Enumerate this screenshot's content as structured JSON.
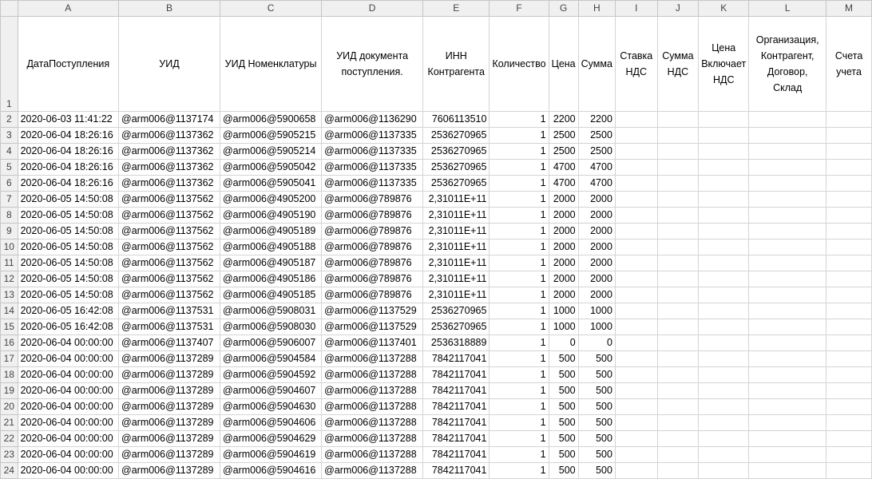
{
  "columns": [
    "A",
    "B",
    "C",
    "D",
    "E",
    "F",
    "G",
    "H",
    "I",
    "J",
    "K",
    "L",
    "M"
  ],
  "header_row_number": "1",
  "headers": [
    "ДатаПоступления",
    "УИД",
    "УИД Номенклатуры",
    "УИД документа поступления.",
    "ИНН Контрагента",
    "Количество",
    "Цена",
    "Сумма",
    "Ставка НДС",
    "Сумма НДС",
    "Цена Включает НДС",
    "Организация, Контрагент, Договор, Склад",
    "Счета учета"
  ],
  "rows": [
    {
      "n": "2",
      "date": "2020-06-03 11:41:22",
      "uid": "@arm006@1137174",
      "nom": "@arm006@5900658",
      "doc": "@arm006@1136290",
      "inn": "7606113510",
      "qty": "1",
      "price": "2200",
      "sum": "2200"
    },
    {
      "n": "3",
      "date": "2020-06-04 18:26:16",
      "uid": "@arm006@1137362",
      "nom": "@arm006@5905215",
      "doc": "@arm006@1137335",
      "inn": "2536270965",
      "qty": "1",
      "price": "2500",
      "sum": "2500"
    },
    {
      "n": "4",
      "date": "2020-06-04 18:26:16",
      "uid": "@arm006@1137362",
      "nom": "@arm006@5905214",
      "doc": "@arm006@1137335",
      "inn": "2536270965",
      "qty": "1",
      "price": "2500",
      "sum": "2500"
    },
    {
      "n": "5",
      "date": "2020-06-04 18:26:16",
      "uid": "@arm006@1137362",
      "nom": "@arm006@5905042",
      "doc": "@arm006@1137335",
      "inn": "2536270965",
      "qty": "1",
      "price": "4700",
      "sum": "4700"
    },
    {
      "n": "6",
      "date": "2020-06-04 18:26:16",
      "uid": "@arm006@1137362",
      "nom": "@arm006@5905041",
      "doc": "@arm006@1137335",
      "inn": "2536270965",
      "qty": "1",
      "price": "4700",
      "sum": "4700"
    },
    {
      "n": "7",
      "date": "2020-06-05 14:50:08",
      "uid": "@arm006@1137562",
      "nom": "@arm006@4905200",
      "doc": "@arm006@789876",
      "inn": "2,31011E+11",
      "qty": "1",
      "price": "2000",
      "sum": "2000"
    },
    {
      "n": "8",
      "date": "2020-06-05 14:50:08",
      "uid": "@arm006@1137562",
      "nom": "@arm006@4905190",
      "doc": "@arm006@789876",
      "inn": "2,31011E+11",
      "qty": "1",
      "price": "2000",
      "sum": "2000"
    },
    {
      "n": "9",
      "date": "2020-06-05 14:50:08",
      "uid": "@arm006@1137562",
      "nom": "@arm006@4905189",
      "doc": "@arm006@789876",
      "inn": "2,31011E+11",
      "qty": "1",
      "price": "2000",
      "sum": "2000"
    },
    {
      "n": "10",
      "date": "2020-06-05 14:50:08",
      "uid": "@arm006@1137562",
      "nom": "@arm006@4905188",
      "doc": "@arm006@789876",
      "inn": "2,31011E+11",
      "qty": "1",
      "price": "2000",
      "sum": "2000"
    },
    {
      "n": "11",
      "date": "2020-06-05 14:50:08",
      "uid": "@arm006@1137562",
      "nom": "@arm006@4905187",
      "doc": "@arm006@789876",
      "inn": "2,31011E+11",
      "qty": "1",
      "price": "2000",
      "sum": "2000"
    },
    {
      "n": "12",
      "date": "2020-06-05 14:50:08",
      "uid": "@arm006@1137562",
      "nom": "@arm006@4905186",
      "doc": "@arm006@789876",
      "inn": "2,31011E+11",
      "qty": "1",
      "price": "2000",
      "sum": "2000"
    },
    {
      "n": "13",
      "date": "2020-06-05 14:50:08",
      "uid": "@arm006@1137562",
      "nom": "@arm006@4905185",
      "doc": "@arm006@789876",
      "inn": "2,31011E+11",
      "qty": "1",
      "price": "2000",
      "sum": "2000"
    },
    {
      "n": "14",
      "date": "2020-06-05 16:42:08",
      "uid": "@arm006@1137531",
      "nom": "@arm006@5908031",
      "doc": "@arm006@1137529",
      "inn": "2536270965",
      "qty": "1",
      "price": "1000",
      "sum": "1000"
    },
    {
      "n": "15",
      "date": "2020-06-05 16:42:08",
      "uid": "@arm006@1137531",
      "nom": "@arm006@5908030",
      "doc": "@arm006@1137529",
      "inn": "2536270965",
      "qty": "1",
      "price": "1000",
      "sum": "1000"
    },
    {
      "n": "16",
      "date": "2020-06-04 00:00:00",
      "uid": "@arm006@1137407",
      "nom": "@arm006@5906007",
      "doc": "@arm006@1137401",
      "inn": "2536318889",
      "qty": "1",
      "price": "0",
      "sum": "0"
    },
    {
      "n": "17",
      "date": "2020-06-04 00:00:00",
      "uid": "@arm006@1137289",
      "nom": "@arm006@5904584",
      "doc": "@arm006@1137288",
      "inn": "7842117041",
      "qty": "1",
      "price": "500",
      "sum": "500"
    },
    {
      "n": "18",
      "date": "2020-06-04 00:00:00",
      "uid": "@arm006@1137289",
      "nom": "@arm006@5904592",
      "doc": "@arm006@1137288",
      "inn": "7842117041",
      "qty": "1",
      "price": "500",
      "sum": "500"
    },
    {
      "n": "19",
      "date": "2020-06-04 00:00:00",
      "uid": "@arm006@1137289",
      "nom": "@arm006@5904607",
      "doc": "@arm006@1137288",
      "inn": "7842117041",
      "qty": "1",
      "price": "500",
      "sum": "500"
    },
    {
      "n": "20",
      "date": "2020-06-04 00:00:00",
      "uid": "@arm006@1137289",
      "nom": "@arm006@5904630",
      "doc": "@arm006@1137288",
      "inn": "7842117041",
      "qty": "1",
      "price": "500",
      "sum": "500"
    },
    {
      "n": "21",
      "date": "2020-06-04 00:00:00",
      "uid": "@arm006@1137289",
      "nom": "@arm006@5904606",
      "doc": "@arm006@1137288",
      "inn": "7842117041",
      "qty": "1",
      "price": "500",
      "sum": "500"
    },
    {
      "n": "22",
      "date": "2020-06-04 00:00:00",
      "uid": "@arm006@1137289",
      "nom": "@arm006@5904629",
      "doc": "@arm006@1137288",
      "inn": "7842117041",
      "qty": "1",
      "price": "500",
      "sum": "500"
    },
    {
      "n": "23",
      "date": "2020-06-04 00:00:00",
      "uid": "@arm006@1137289",
      "nom": "@arm006@5904619",
      "doc": "@arm006@1137288",
      "inn": "7842117041",
      "qty": "1",
      "price": "500",
      "sum": "500"
    },
    {
      "n": "24",
      "date": "2020-06-04 00:00:00",
      "uid": "@arm006@1137289",
      "nom": "@arm006@5904616",
      "doc": "@arm006@1137288",
      "inn": "7842117041",
      "qty": "1",
      "price": "500",
      "sum": "500"
    }
  ]
}
